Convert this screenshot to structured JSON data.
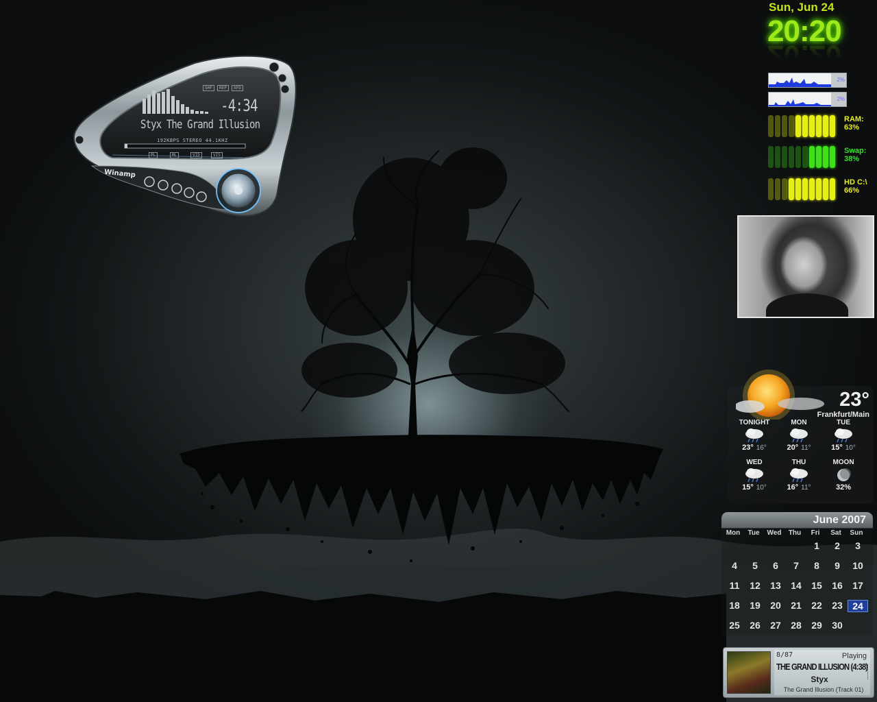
{
  "winamp": {
    "track_title": "Styx The Grand Illusion",
    "time_remaining": "-4:34",
    "stream_info": "192KBPS STEREO 44.1KHZ",
    "toggle_buttons": [
      "SHF",
      "REP",
      "XFD"
    ],
    "panel_buttons": [
      "PL",
      "ML",
      "VID",
      "VIS"
    ],
    "brand_label": "Winamp"
  },
  "system": {
    "date": "Sun, Jun 24",
    "time": "20:20",
    "cpu_graphs": [
      {
        "percent_label": "2%",
        "value": 0.02
      },
      {
        "percent_label": "2%",
        "value": 0.02
      }
    ],
    "meters": [
      {
        "label": "RAM:",
        "value_label": "63%",
        "value": 0.63,
        "color": "#e6ef12",
        "label_color": "#e9ee1f"
      },
      {
        "label": "Swap:",
        "value_label": "38%",
        "value": 0.38,
        "color": "#3fe01a",
        "label_color": "#36e32a"
      },
      {
        "label": "HD C:\\",
        "value_label": "66%",
        "value": 0.66,
        "color": "#e6ef12",
        "label_color": "#e9ee1f"
      }
    ]
  },
  "weather": {
    "current_temp": "23°",
    "city": "Frankfurt/Main",
    "current_icon": "sun-cloud-icon",
    "forecast": [
      {
        "day": "TONIGHT",
        "high": "23°",
        "low": "16°",
        "icon": "rain-cloud-icon"
      },
      {
        "day": "MON",
        "high": "20°",
        "low": "11°",
        "icon": "rain-cloud-icon"
      },
      {
        "day": "TUE",
        "high": "15°",
        "low": "10°",
        "icon": "rain-cloud-icon"
      },
      {
        "day": "WED",
        "high": "15°",
        "low": "10°",
        "icon": "rain-cloud-icon"
      },
      {
        "day": "THU",
        "high": "16°",
        "low": "11°",
        "icon": "rain-cloud-icon"
      },
      {
        "day": "MOON",
        "high": "32%",
        "low": "",
        "icon": "moon-icon"
      }
    ]
  },
  "calendar": {
    "month_label": "June 2007",
    "weekdays": [
      "Mon",
      "Tue",
      "Wed",
      "Thu",
      "Fri",
      "Sat",
      "Sun"
    ],
    "first_weekday_index": 4,
    "days_in_month": 30,
    "today": 24,
    "today_color": "#1f3f9a"
  },
  "now_playing": {
    "track_counter": "8/87",
    "state": "Playing",
    "title": "THE GRAND ILLUSION (4:38)",
    "artist": "Styx",
    "album": "The Grand Illusion (Track 01)"
  }
}
